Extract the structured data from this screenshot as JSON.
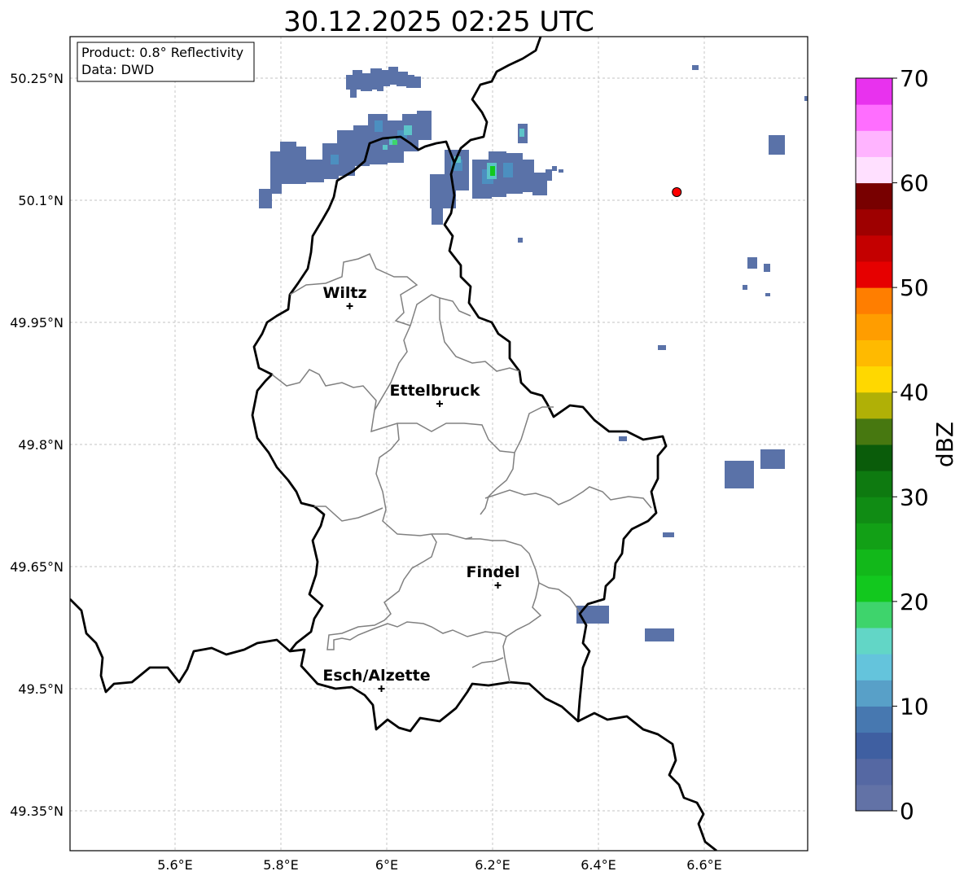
{
  "title": "30.12.2025 02:25 UTC",
  "info_box": {
    "product": "Product: 0.8° Reflectivity",
    "data": "Data: DWD"
  },
  "map": {
    "lon_ticks": [
      {
        "lon": 5.6,
        "label": "5.6°E"
      },
      {
        "lon": 5.8,
        "label": "5.8°E"
      },
      {
        "lon": 6.0,
        "label": "6°E"
      },
      {
        "lon": 6.2,
        "label": "6.2°E"
      },
      {
        "lon": 6.4,
        "label": "6.4°E"
      },
      {
        "lon": 6.6,
        "label": "6.6°E"
      }
    ],
    "lat_ticks": [
      {
        "lat": 50.25,
        "label": "50.25°N"
      },
      {
        "lat": 50.1,
        "label": "50.1°N"
      },
      {
        "lat": 49.95,
        "label": "49.95°N"
      },
      {
        "lat": 49.8,
        "label": "49.8°N"
      },
      {
        "lat": 49.65,
        "label": "49.65°N"
      },
      {
        "lat": 49.5,
        "label": "49.5°N"
      },
      {
        "lat": 49.35,
        "label": "49.35°N"
      }
    ],
    "grid": true,
    "cities": [
      {
        "name": "Wiltz",
        "lon": 5.93,
        "lat": 49.97
      },
      {
        "name": "Ettelbruck",
        "lon": 6.1,
        "lat": 49.85
      },
      {
        "name": "Findel",
        "lon": 6.21,
        "lat": 49.627
      },
      {
        "name": "Esch/Alzette",
        "lon": 5.99,
        "lat": 49.5
      }
    ],
    "radar_marker": {
      "lon": 6.548,
      "lat": 50.11,
      "color": "#ff0000"
    }
  },
  "colorbar": {
    "label": "dBZ",
    "ticks": [
      "0",
      "10",
      "20",
      "30",
      "40",
      "50",
      "60",
      "70"
    ],
    "tick_values": [
      0,
      10,
      20,
      30,
      40,
      50,
      60,
      70
    ],
    "min": 0,
    "max": 70,
    "colors": [
      "#6272a6",
      "#5568a3",
      "#3f5fa1",
      "#4778b0",
      "#58a0c8",
      "#64c4dc",
      "#62d6c6",
      "#3ed46c",
      "#12c81e",
      "#12b81a",
      "#12a016",
      "#108c14",
      "#0e7a10",
      "#0a5c0a",
      "#477810",
      "#b0b006",
      "#ffd800",
      "#ffba00",
      "#ff9d00",
      "#ff7e00",
      "#e60000",
      "#c40000",
      "#9e0000",
      "#780000",
      "#ffe0ff",
      "#ffb4ff",
      "#ff6eff",
      "#e832ee"
    ]
  }
}
